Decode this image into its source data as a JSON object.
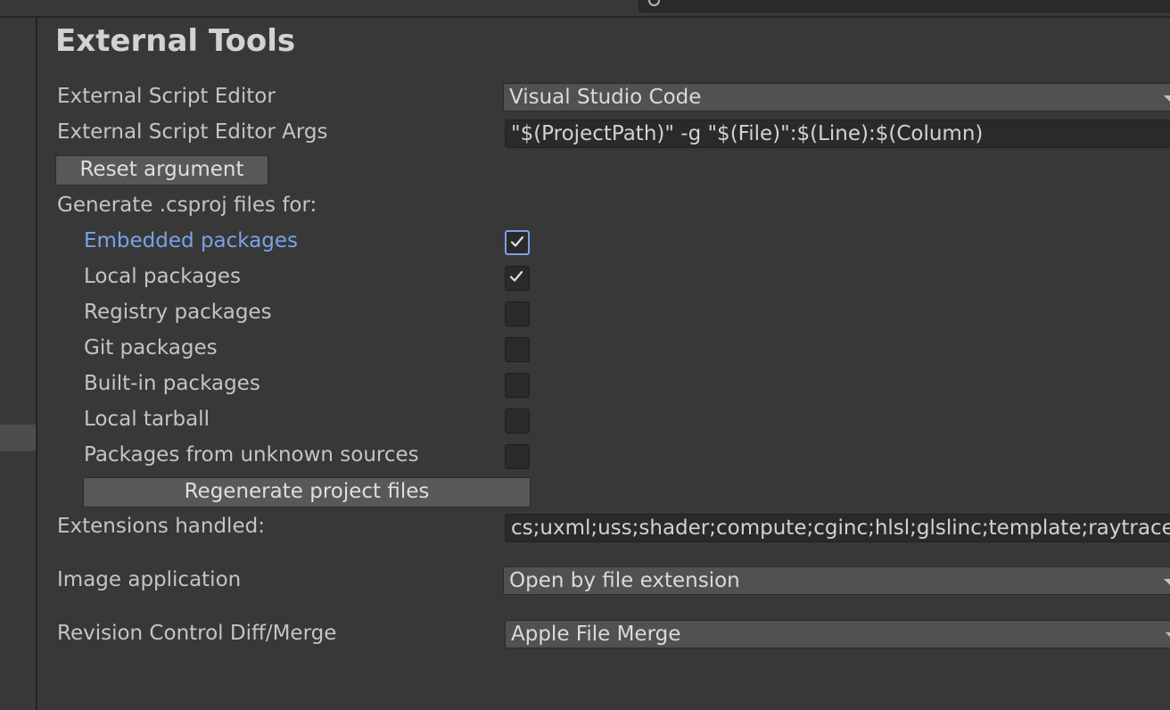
{
  "search": {
    "icon": "search-icon"
  },
  "panel": {
    "title": "External Tools",
    "script_editor": {
      "label": "External Script Editor",
      "value": "Visual Studio Code"
    },
    "script_editor_args": {
      "label": "External Script Editor Args",
      "value": "\"$(ProjectPath)\" -g \"$(File)\":$(Line):$(Column)"
    },
    "reset_argument_label": "Reset argument",
    "generate_label": "Generate .csproj files for:",
    "packages": [
      {
        "label": "Embedded packages",
        "checked": true
      },
      {
        "label": "Local packages",
        "checked": true
      },
      {
        "label": "Registry packages",
        "checked": false
      },
      {
        "label": "Git packages",
        "checked": false
      },
      {
        "label": "Built-in packages",
        "checked": false
      },
      {
        "label": "Local tarball",
        "checked": false
      },
      {
        "label": "Packages from unknown sources",
        "checked": false
      }
    ],
    "regenerate_label": "Regenerate project files",
    "extensions": {
      "label": "Extensions handled:",
      "value": "cs;uxml;uss;shader;compute;cginc;hlsl;glslinc;template;raytrace;txt"
    },
    "image_application": {
      "label": "Image application",
      "value": "Open by file extension"
    },
    "revision_control": {
      "label": "Revision Control Diff/Merge",
      "value": "Apple File Merge"
    }
  },
  "colors": {
    "background": "#383838",
    "field": "#2a2a2a",
    "focus": "#7ba2e6"
  }
}
